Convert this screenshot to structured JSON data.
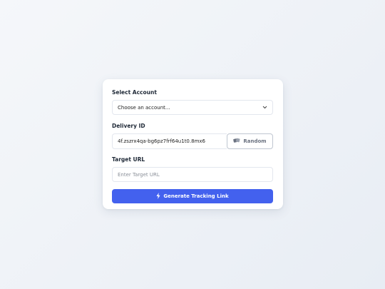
{
  "form": {
    "account_label": "Select Account",
    "account_selected": "Choose an account...",
    "delivery_label": "Delivery ID",
    "delivery_value": "4f.zszrx4qa-bg6pz7frf64u1t0.8mx6",
    "random_label": "Random",
    "target_label": "Target URL",
    "target_placeholder": "Enter Target URL",
    "generate_label": "Generate Tracking Link"
  },
  "icons": {
    "select_chevron": "chevron-down-icon",
    "random": "dice-icon",
    "generate": "lightning-bolt-icon"
  },
  "colors": {
    "primary": "#4361ee",
    "random_text": "#6b7280"
  }
}
